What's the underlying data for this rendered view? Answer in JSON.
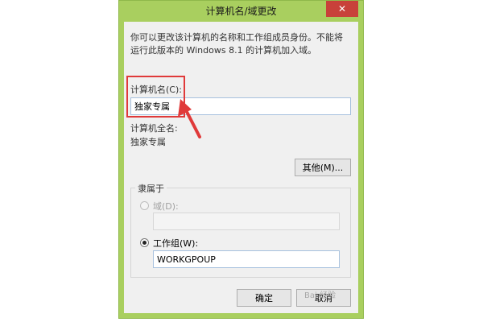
{
  "window": {
    "title": "计算机名/域更改",
    "close_symbol": "✕"
  },
  "description": "你可以更改该计算机的名称和工作组成员身份。不能将运行此版本的 Windows 8.1 的计算机加入域。",
  "computer_name": {
    "label": "计算机名(C):",
    "value": "独家专属"
  },
  "full_name": {
    "label": "计算机全名:",
    "value": "独家专属"
  },
  "buttons": {
    "other": "其他(M)...",
    "ok": "确定",
    "cancel": "取消"
  },
  "member_of": {
    "label": "隶属于",
    "domain_label": "域(D):",
    "domain_value": "",
    "workgroup_label": "工作组(W):",
    "workgroup_value": "WORKGPOUP",
    "selected": "workgroup"
  },
  "watermark": "Bai 经验",
  "colors": {
    "frame": "#a9cf5f",
    "highlight": "#e03a3a",
    "close_button": "#c8413a"
  }
}
